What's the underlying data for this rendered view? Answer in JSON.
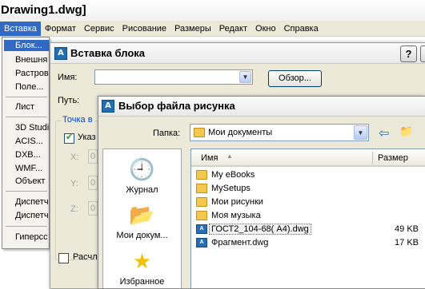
{
  "app": {
    "title": "Drawing1.dwg]"
  },
  "menubar": {
    "items": [
      "Вставка",
      "Формат",
      "Сервис",
      "Рисование",
      "Размеры",
      "Редакт",
      "Окно",
      "Справка"
    ]
  },
  "insert_menu": {
    "items": [
      "Блок...",
      "Внешня",
      "Растров",
      "Поле...",
      "Лист",
      "3D Studi",
      "ACIS...",
      "DXB...",
      "WMF...",
      "Объект",
      "Диспетч",
      "Диспетч",
      "Гиперсс"
    ]
  },
  "insert_block_dialog": {
    "title": "Вставка блока",
    "help_label": "?",
    "name_label": "Имя:",
    "name_value": "",
    "browse_label": "Обзор...",
    "path_label": "Путь:",
    "insertion_point_legend": "Точка в",
    "specify_label": "Указ",
    "x_label": "X:",
    "y_label": "Y:",
    "z_label": "Z:",
    "x_value": "0",
    "y_value": "0",
    "z_value": "0",
    "explode_label": "Расчле"
  },
  "file_dialog": {
    "title": "Выбор файла рисунка",
    "folder_label": "Папка:",
    "folder_value": "Мои документы",
    "places": [
      {
        "label": "Журнал",
        "icon": "history-icon"
      },
      {
        "label": "Мои докум...",
        "icon": "my-documents-icon"
      },
      {
        "label": "Избранное",
        "icon": "favorites-star-icon"
      }
    ],
    "columns": {
      "name": "Имя",
      "size": "Размер"
    },
    "files": [
      {
        "name": "My eBooks",
        "size": "",
        "type": "folder"
      },
      {
        "name": "MySetups",
        "size": "",
        "type": "folder"
      },
      {
        "name": "Мои рисунки",
        "size": "",
        "type": "folder"
      },
      {
        "name": "Моя музыка",
        "size": "",
        "type": "folder"
      },
      {
        "name": "ГОСТ2_104-68( А4).dwg",
        "size": "49 KB",
        "type": "dwg"
      },
      {
        "name": "Фрагмент.dwg",
        "size": "17 KB",
        "type": "dwg"
      }
    ]
  },
  "colors": {
    "menu_highlight": "#316ac5",
    "dialog_face": "#ece9d8",
    "group_title": "#0046d5"
  }
}
